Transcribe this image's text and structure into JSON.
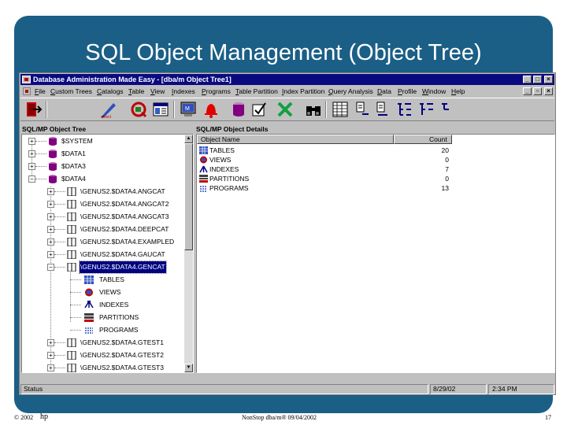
{
  "slide": {
    "title": "SQL Object Management (Object Tree)",
    "footer_left": "© 2002",
    "footer_logo": "hp",
    "footer_center": "NonStop dba/m® 09/04/2002",
    "footer_page": "17",
    "background_color": "#1b5f86"
  },
  "window": {
    "title": "Database Administration Made Easy - [dba/m Object Tree1]",
    "title_buttons": [
      "_",
      "□",
      "×"
    ],
    "child_buttons": [
      "_",
      "▫",
      "×"
    ]
  },
  "menu": [
    "File",
    "Custom Trees",
    "Catalogs",
    "Table",
    "View",
    "Indexes",
    "Programs",
    "Table Partition",
    "Index Partition",
    "Query Analysis",
    "Data",
    "Profile",
    "Window",
    "Help"
  ],
  "toolbar": {
    "buttons": [
      "exit-icon",
      "select-icon",
      "query-icon",
      "properties-icon",
      "monitor-icon",
      "alarm-bell-icon",
      "database-icon",
      "check-icon",
      "delete-icon",
      "binoculars-icon",
      "grid-icon",
      "document-a-icon",
      "document-b-icon",
      "tree-a-icon",
      "tree-b-icon",
      "tree-c-icon"
    ],
    "select_label": "select"
  },
  "left_pane": {
    "label": "SQL/MP Object Tree",
    "volumes": [
      "$SYSTEM",
      "$DATA1",
      "$DATA3",
      "$DATA4"
    ],
    "catalogs": [
      "\\GENUS2.$DATA4.ANGCAT",
      "\\GENUS2.$DATA4.ANGCAT2",
      "\\GENUS2.$DATA4.ANGCAT3",
      "\\GENUS2.$DATA4.DEEPCAT",
      "\\GENUS2.$DATA4.EXAMPLED",
      "\\GENUS2.$DATA4.GAUCAT",
      "\\GENUS2.$DATA4.GENCAT"
    ],
    "selected_catalog": "\\GENUS2.$DATA4.GENCAT",
    "children": [
      "TABLES",
      "VIEWS",
      "INDEXES",
      "PARTITIONS",
      "PROGRAMS"
    ],
    "catalogs_after": [
      "\\GENUS2.$DATA4.GTEST1",
      "\\GENUS2.$DATA4.GTEST2",
      "\\GENUS2.$DATA4.GTEST3"
    ]
  },
  "right_pane": {
    "label": "SQL/MP Object Details",
    "col_name": "Object Name",
    "col_count": "Count",
    "rows": [
      {
        "name": "TABLES",
        "count": "20"
      },
      {
        "name": "VIEWS",
        "count": "0"
      },
      {
        "name": "INDEXES",
        "count": "7"
      },
      {
        "name": "PARTITIONS",
        "count": "0"
      },
      {
        "name": "PROGRAMS",
        "count": "13"
      }
    ]
  },
  "status": {
    "text": "Status",
    "date": "8/29/02",
    "time": "2:34 PM"
  }
}
